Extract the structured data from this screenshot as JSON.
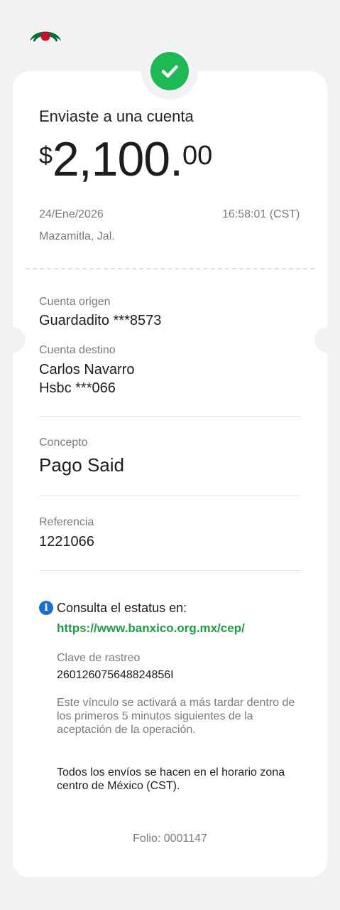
{
  "header": {
    "logo": "bank-logo"
  },
  "status": {
    "icon": "checkmark-icon",
    "color": "#1db954"
  },
  "receipt": {
    "title": "Enviaste a una cuenta",
    "amount": {
      "currency": "$",
      "integer": "2,100.",
      "decimals": "00"
    },
    "date": "24/Ene/2026",
    "time": "16:58:01 (CST)",
    "location": "Mazamitla, Jal."
  },
  "details": {
    "origin_label": "Cuenta origen",
    "origin_value": "Guardadito ***8573",
    "dest_label": "Cuenta destino",
    "dest_name": "Carlos Navarro",
    "dest_account": "Hsbc ***066",
    "concept_label": "Concepto",
    "concept_value": "Pago Said",
    "reference_label": "Referencia",
    "reference_value": "1221066"
  },
  "info": {
    "icon": "info-icon",
    "heading": "Consulta el estatus en:",
    "link": "https://www.banxico.org.mx/cep/",
    "tracking_label": "Clave de rastreo",
    "tracking_value": "260126075648824856I",
    "activation_note": "Este vínculo se activará a más tardar dentro de los primeros 5 minutos siguientes de la aceptación de la operación.",
    "timezone_note": "Todos los envíos se hacen en el horario zona centro de México (CST)."
  },
  "footer": {
    "folio": "Folio: 0001147"
  },
  "colors": {
    "accent_green": "#1f9d45",
    "info_blue": "#1b6fd1",
    "logo_red": "#c8102e",
    "logo_green": "#0b6b3a"
  }
}
